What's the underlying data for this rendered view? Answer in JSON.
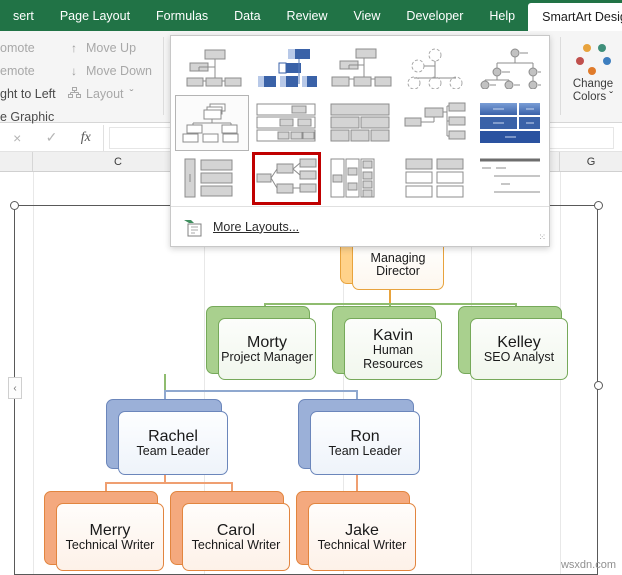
{
  "ribbon_tabs": [
    {
      "label": "sert",
      "active": false
    },
    {
      "label": "Page Layout",
      "active": false
    },
    {
      "label": "Formulas",
      "active": false
    },
    {
      "label": "Data",
      "active": false
    },
    {
      "label": "Review",
      "active": false
    },
    {
      "label": "View",
      "active": false
    },
    {
      "label": "Developer",
      "active": false
    },
    {
      "label": "Help",
      "active": false
    },
    {
      "label": "SmartArt Design",
      "active": true
    }
  ],
  "ribbon": {
    "create_graphic": {
      "promote": "omote",
      "demote": "emote",
      "right_to_left": "ght to Left",
      "group_label": "e Graphic",
      "move_up": "Move Up",
      "move_down": "Move Down",
      "layout": "Layout",
      "move_up_icon": "arrow-up-icon",
      "move_down_icon": "arrow-down-icon",
      "layout_icon": "layout-icon",
      "dropdown_caret": "ˇ"
    },
    "change_colors": {
      "line1": "Change",
      "line2": "Colors",
      "caret": "ˇ",
      "dot_colors": [
        "#e8a33d",
        "#3f8f7a",
        "#c0504d",
        "#3d7ebf",
        "#e07b2a"
      ]
    }
  },
  "formula_bar": {
    "cancel_icon": "×",
    "confirm_icon": "✓",
    "function_icon": "fx",
    "value": "",
    "placeholder": ""
  },
  "column_headers": [
    "C",
    "G"
  ],
  "smartart": {
    "collapse_arrow": "‹",
    "nodes": [
      {
        "id": "md",
        "name": "Managing",
        "role": "Director",
        "level": 0
      },
      {
        "id": "morty",
        "name": "Morty",
        "role": "Project Manager",
        "level": 1
      },
      {
        "id": "kavin",
        "name": "Kavin",
        "role": "Human Resources",
        "level": 1
      },
      {
        "id": "kelley",
        "name": "Kelley",
        "role": "SEO Analyst",
        "level": 1
      },
      {
        "id": "rachel",
        "name": "Rachel",
        "role": "Team Leader",
        "level": 2
      },
      {
        "id": "ron",
        "name": "Ron",
        "role": "Team Leader",
        "level": 2
      },
      {
        "id": "merry",
        "name": "Merry",
        "role": "Technical Writer",
        "level": 3
      },
      {
        "id": "carol",
        "name": "Carol",
        "role": "Technical Writer",
        "level": 3
      },
      {
        "id": "jake",
        "name": "Jake",
        "role": "Technical Writer",
        "level": 3
      }
    ]
  },
  "layout_gallery": {
    "selected_index": 5,
    "highlighted_index": 11,
    "more_layouts_label": "More Layouts...",
    "more_layouts_icon": "more-layouts-icon",
    "resize_grip": "⁙"
  },
  "watermark": "wsxdn.com"
}
